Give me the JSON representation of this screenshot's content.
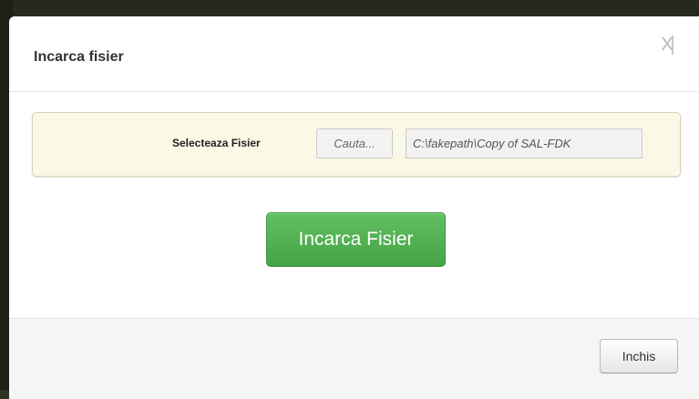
{
  "dialog": {
    "title": "Incarca fisier",
    "close_icon_glyph": "X"
  },
  "file_select": {
    "label": "Selecteaza Fisier",
    "browse_label": "Cauta...",
    "path_value": "C:\\fakepath\\Copy of SAL-FDK"
  },
  "actions": {
    "upload_label": "Incarca Fisier",
    "close_label": "Inchis"
  },
  "colors": {
    "accent_green": "#4cae4c",
    "panel_background": "#fcf8e6",
    "footer_background": "#f5f5f5"
  }
}
